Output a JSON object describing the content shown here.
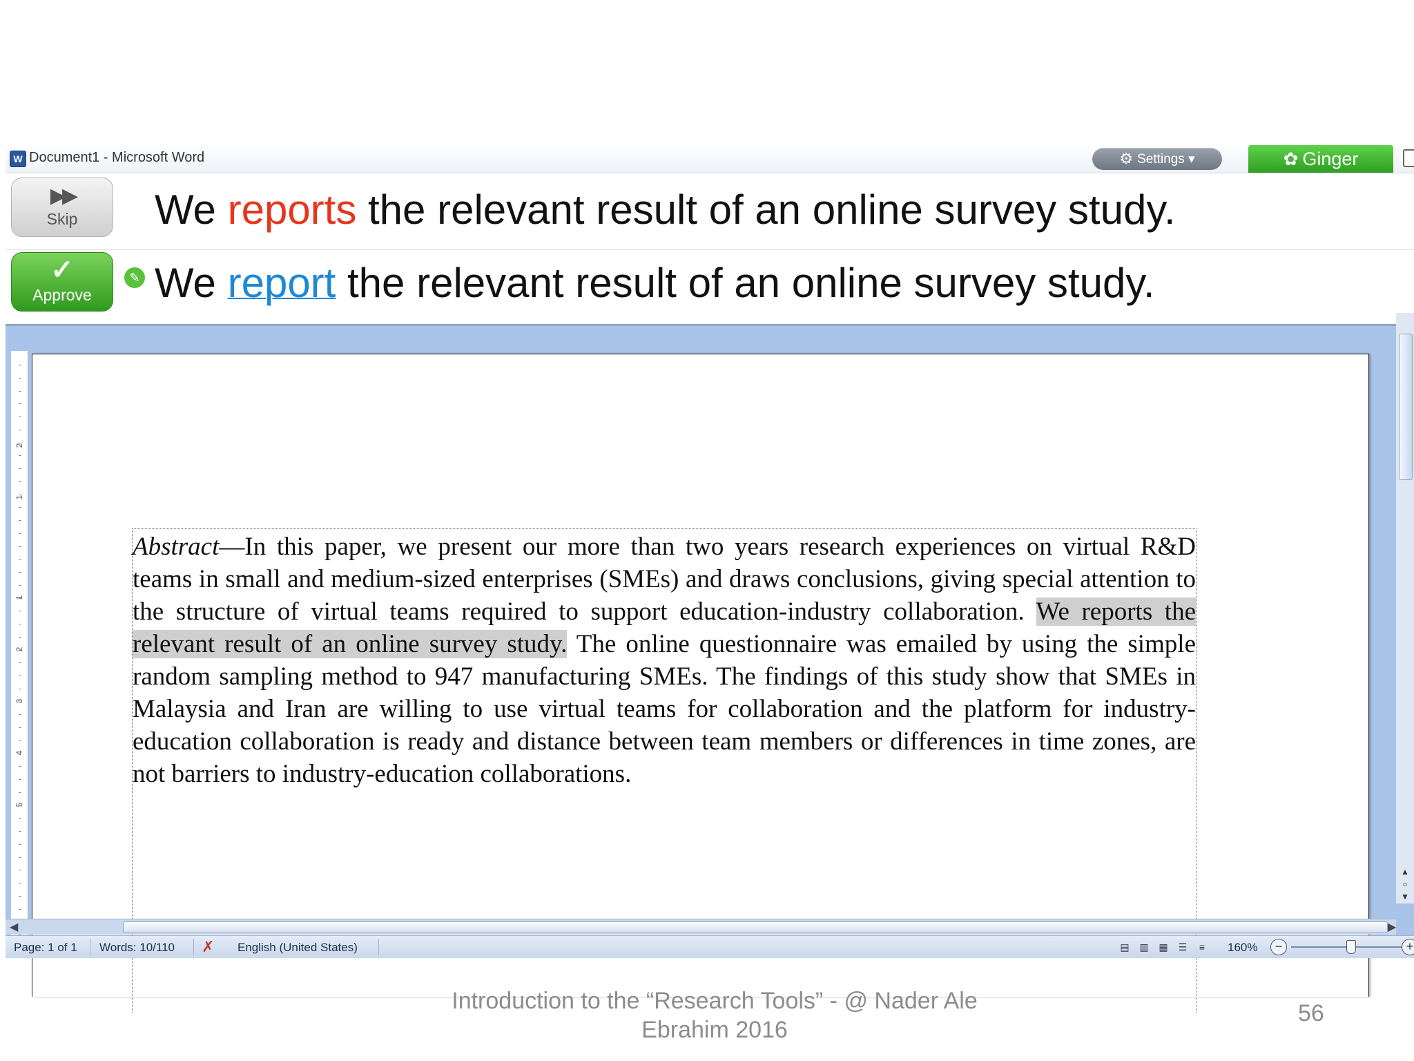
{
  "window": {
    "title": "Document1 - Microsoft Word",
    "app_icon": "W"
  },
  "ginger": {
    "settings_label": "Settings",
    "settings_icon": "gear-icon",
    "brand_label": "Ginger",
    "skip_label": "Skip",
    "approve_label": "Approve",
    "original": {
      "before": "We ",
      "error_word": "reports",
      "after": " the relevant result of an online survey study."
    },
    "suggestion": {
      "before": "We ",
      "fixed_word": "report",
      "after": " the relevant result of an online survey study."
    },
    "colors": {
      "error": "#e8341c",
      "correction": "#1e88d4",
      "approve": "#3aa826"
    }
  },
  "document": {
    "abstract_lead": "Abstract",
    "abstract_dash": "—",
    "abstract_part1": "In this paper, we present our more than two years research experiences on virtual R&D teams in small and medium-sized enterprises (SMEs) and draws conclusions, giving special attention to the structure of virtual teams required to support education-industry collaboration. ",
    "highlighted_sentence": "We reports the relevant result of an online survey study.",
    "abstract_part2": " The online questionnaire was emailed by using the simple random sampling method to 947 manufacturing SMEs. The findings of this study show that SMEs in Malaysia and Iran are willing to use virtual teams for collaboration and the platform for industry-education collaboration is ready and distance between team members or differences in time zones, are not barriers to industry-education collaborations."
  },
  "ruler": {
    "labels": [
      "2",
      "1",
      "1",
      "2",
      "3",
      "4",
      "5"
    ]
  },
  "statusbar": {
    "page": "Page: 1 of 1",
    "words": "Words: 10/110",
    "language": "English (United States)",
    "zoom": "160%"
  },
  "slide": {
    "footer": "Introduction to the “Research Tools” - @ Nader Ale Ebrahim 2016",
    "page_number": "56"
  }
}
